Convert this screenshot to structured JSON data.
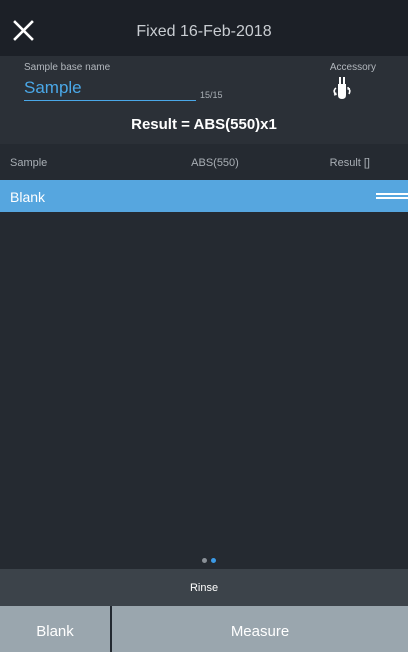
{
  "header": {
    "title": "Fixed 16-Feb-2018",
    "close_icon": "close-icon"
  },
  "sample_base_name": {
    "label": "Sample base name",
    "value": "Sample",
    "char_count": "15/15"
  },
  "accessory": {
    "label": "Accessory",
    "icon": "cuvette-accessory-icon"
  },
  "result_formula": "Result = ABS(550)x1",
  "table": {
    "columns": [
      "Sample",
      "ABS(550)",
      "Result []"
    ],
    "rows": [
      {
        "sample": "Blank",
        "selected": true
      }
    ]
  },
  "pager": {
    "count": 2,
    "active_index": 2
  },
  "rinse_label": "Rinse",
  "buttons": {
    "blank_label": "Blank",
    "measure_label": "Measure"
  },
  "colors": {
    "accent": "#4aa8e8",
    "selected_row": "#56a6df",
    "button_bg": "#9aa6ae",
    "background": "#252a31"
  }
}
